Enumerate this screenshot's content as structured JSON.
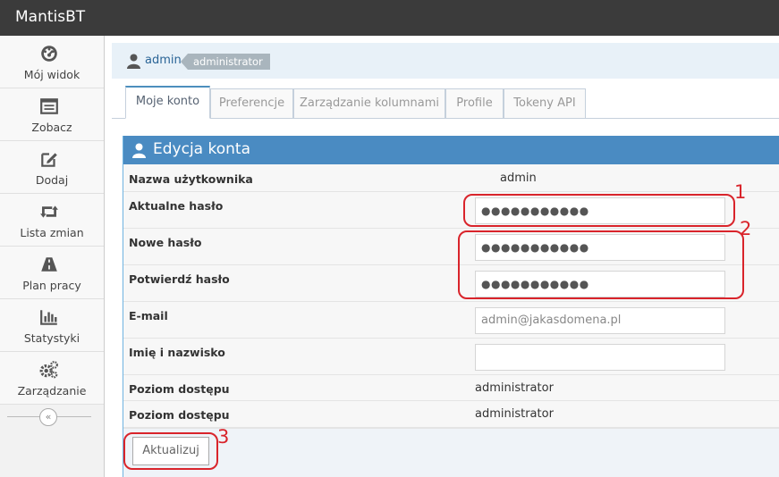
{
  "app": {
    "title": "MantisBT"
  },
  "sidebar": {
    "items": [
      {
        "label": "Mój widok",
        "icon": "dashboard-icon"
      },
      {
        "label": "Zobacz",
        "icon": "list-icon"
      },
      {
        "label": "Dodaj",
        "icon": "edit-icon"
      },
      {
        "label": "Lista zmian",
        "icon": "retweet-icon"
      },
      {
        "label": "Plan pracy",
        "icon": "road-icon"
      },
      {
        "label": "Statystyki",
        "icon": "bar-chart-icon"
      },
      {
        "label": "Zarządzanie",
        "icon": "gears-icon"
      }
    ],
    "collapse_glyph": "«"
  },
  "breadcrumb": {
    "user": "admin",
    "role": "administrator"
  },
  "tabs": [
    {
      "label": "Moje konto",
      "active": true
    },
    {
      "label": "Preferencje"
    },
    {
      "label": "Zarządzanie kolumnami"
    },
    {
      "label": "Profile"
    },
    {
      "label": "Tokeny API"
    }
  ],
  "form": {
    "title": "Edycja konta",
    "rows": [
      {
        "label": "Nazwa użytkownika",
        "value": "admin"
      },
      {
        "label": "Aktualne hasło",
        "value": "●●●●●●●●●●●"
      },
      {
        "label": "Nowe hasło",
        "value": "●●●●●●●●●●●"
      },
      {
        "label": "Potwierdź hasło",
        "value": "●●●●●●●●●●●"
      },
      {
        "label": "E-mail",
        "value": "admin@jakasdomena.pl"
      },
      {
        "label": "Imię i nazwisko",
        "value": ""
      },
      {
        "label": "Poziom dostępu",
        "value": "administrator"
      },
      {
        "label": "Poziom dostępu",
        "value": "administrator"
      }
    ],
    "submit_label": "Aktualizuj"
  },
  "annotations": {
    "n1": "1",
    "n2": "2",
    "n3": "3",
    "color": "#d9242b"
  },
  "colors": {
    "topbar": "#3b3b3b",
    "panel_header": "#4a8bc2",
    "link": "#2a6496"
  }
}
